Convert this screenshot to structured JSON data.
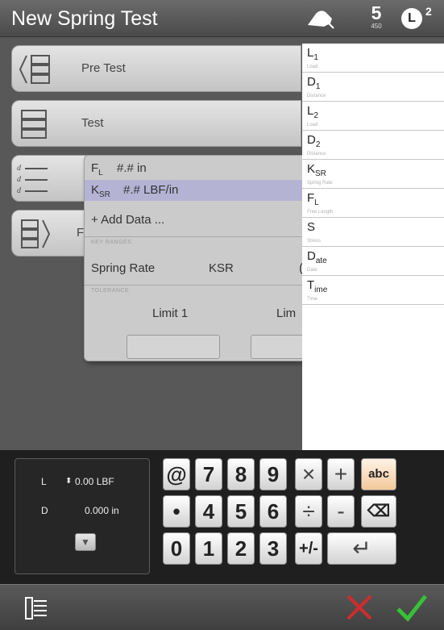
{
  "header": {
    "title": "New Spring Test",
    "sample_number": "5",
    "sample_sub": "450",
    "badge_letter": "L",
    "badge_sup": "2"
  },
  "menu": {
    "items": [
      {
        "label": "Pre Test",
        "icon": "pre-test-icon"
      },
      {
        "label": "Test",
        "icon": "test-icon"
      },
      {
        "label": "",
        "icon": "data-list-icon"
      },
      {
        "label": "F",
        "icon": "post-test-icon"
      }
    ]
  },
  "popup": {
    "rows": [
      {
        "key": "FL",
        "key_base": "F",
        "key_sub": "L",
        "value": "#.# in"
      },
      {
        "key": "KSR",
        "key_base": "K",
        "key_sub": "SR",
        "value": "#.# LBF/in"
      }
    ],
    "add_data": "+ Add Data ...",
    "key_params_caption": "KEY RANGES",
    "spring_rate_label": "Spring Rate",
    "spring_rate_key": "KSR",
    "spring_rate_extra": "(",
    "tolerance_caption": "TOLERANCE",
    "limit1_label": "Limit 1",
    "limit2_label": "Lim"
  },
  "params": [
    {
      "base": "L",
      "sub": "1",
      "desc": "Load"
    },
    {
      "base": "D",
      "sub": "1",
      "desc": "Distance"
    },
    {
      "base": "L",
      "sub": "2",
      "desc": "Load"
    },
    {
      "base": "D",
      "sub": "2",
      "desc": "Distance"
    },
    {
      "base": "K",
      "sub": "SR",
      "desc": "Spring Rate"
    },
    {
      "base": "F",
      "sub": "L",
      "desc": "Free Length"
    },
    {
      "base": "S",
      "sub": "",
      "desc": "Stress"
    },
    {
      "base": "D",
      "sub": "ate",
      "desc": "Date"
    },
    {
      "base": "T",
      "sub": "ime",
      "desc": "Time"
    }
  ],
  "readout": {
    "l_label": "L",
    "l_value": "0.00 LBF",
    "d_label": "D",
    "d_value": "0.000 in"
  },
  "keypad": {
    "row1": [
      "@",
      "7",
      "8",
      "9",
      "×",
      "+",
      "abc"
    ],
    "row2": [
      "•",
      "4",
      "5",
      "6",
      "÷",
      "-",
      "⌫"
    ],
    "row3": [
      "0",
      "1",
      "2",
      "3",
      "+/-",
      "↵"
    ]
  },
  "colors": {
    "accept": "#37c137",
    "cancel": "#d22b2b",
    "selection": "#b5b3d4"
  }
}
